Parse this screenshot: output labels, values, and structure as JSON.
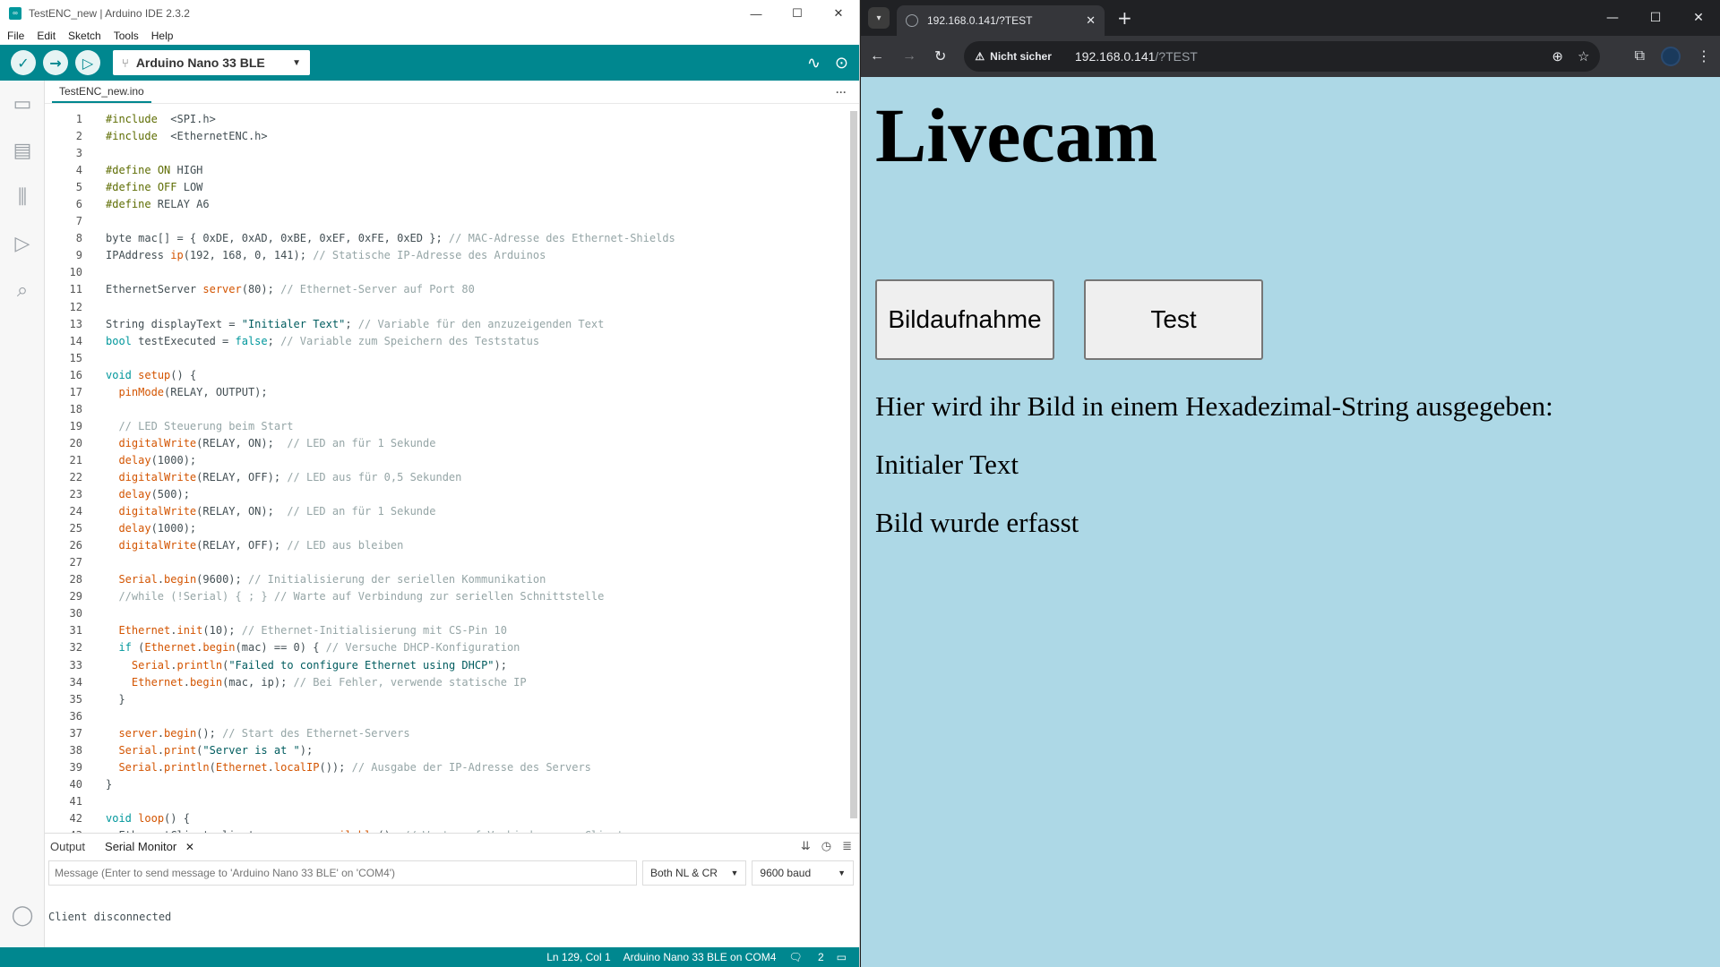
{
  "ide": {
    "window_title": "TestENC_new | Arduino IDE 2.3.2",
    "menu": [
      "File",
      "Edit",
      "Sketch",
      "Tools",
      "Help"
    ],
    "board": "Arduino Nano 33 BLE",
    "file_tab": "TestENC_new.ino",
    "code_lines": [
      [
        [
          "pp",
          "#include"
        ],
        [
          "",
          "  "
        ],
        [
          "",
          "<SPI.h>"
        ]
      ],
      [
        [
          "pp",
          "#include"
        ],
        [
          "",
          "  "
        ],
        [
          "",
          "<EthernetENC.h>"
        ]
      ],
      [],
      [
        [
          "pp",
          "#define"
        ],
        [
          "",
          " "
        ],
        [
          "pp",
          "ON"
        ],
        [
          "",
          " HIGH"
        ]
      ],
      [
        [
          "pp",
          "#define"
        ],
        [
          "",
          " "
        ],
        [
          "pp",
          "OFF"
        ],
        [
          "",
          " LOW"
        ]
      ],
      [
        [
          "pp",
          "#define"
        ],
        [
          "",
          " RELAY A6"
        ]
      ],
      [],
      [
        [
          "",
          "byte mac[] = { 0xDE, 0xAD, 0xBE, 0xEF, 0xFE, 0xED }; "
        ],
        [
          "cm",
          "// MAC-Adresse des Ethernet-Shields"
        ]
      ],
      [
        [
          "",
          "IPAddress "
        ],
        [
          "fn",
          "ip"
        ],
        [
          "",
          "(192, 168, 0, 141); "
        ],
        [
          "cm",
          "// Statische IP-Adresse des Arduinos"
        ]
      ],
      [],
      [
        [
          "",
          "EthernetServer "
        ],
        [
          "fn",
          "server"
        ],
        [
          "",
          "(80); "
        ],
        [
          "cm",
          "// Ethernet-Server auf Port 80"
        ]
      ],
      [],
      [
        [
          "",
          "String displayText = "
        ],
        [
          "str",
          "\"Initialer Text\""
        ],
        [
          "",
          "; "
        ],
        [
          "cm",
          "// Variable für den anzuzeigenden Text"
        ]
      ],
      [
        [
          "kw",
          "bool"
        ],
        [
          "",
          " testExecuted = "
        ],
        [
          "kw",
          "false"
        ],
        [
          "",
          "; "
        ],
        [
          "cm",
          "// Variable zum Speichern des Teststatus"
        ]
      ],
      [],
      [
        [
          "kw",
          "void"
        ],
        [
          "",
          " "
        ],
        [
          "fn",
          "setup"
        ],
        [
          "",
          "() {"
        ]
      ],
      [
        [
          "",
          "  "
        ],
        [
          "fn",
          "pinMode"
        ],
        [
          "",
          "(RELAY, OUTPUT);"
        ]
      ],
      [],
      [
        [
          "cm",
          "  // LED Steuerung beim Start"
        ]
      ],
      [
        [
          "",
          "  "
        ],
        [
          "fn",
          "digitalWrite"
        ],
        [
          "",
          "(RELAY, ON);  "
        ],
        [
          "cm",
          "// LED an für 1 Sekunde"
        ]
      ],
      [
        [
          "",
          "  "
        ],
        [
          "fn",
          "delay"
        ],
        [
          "",
          "(1000);"
        ]
      ],
      [
        [
          "",
          "  "
        ],
        [
          "fn",
          "digitalWrite"
        ],
        [
          "",
          "(RELAY, OFF); "
        ],
        [
          "cm",
          "// LED aus für 0,5 Sekunden"
        ]
      ],
      [
        [
          "",
          "  "
        ],
        [
          "fn",
          "delay"
        ],
        [
          "",
          "(500);"
        ]
      ],
      [
        [
          "",
          "  "
        ],
        [
          "fn",
          "digitalWrite"
        ],
        [
          "",
          "(RELAY, ON);  "
        ],
        [
          "cm",
          "// LED an für 1 Sekunde"
        ]
      ],
      [
        [
          "",
          "  "
        ],
        [
          "fn",
          "delay"
        ],
        [
          "",
          "(1000);"
        ]
      ],
      [
        [
          "",
          "  "
        ],
        [
          "fn",
          "digitalWrite"
        ],
        [
          "",
          "(RELAY, OFF); "
        ],
        [
          "cm",
          "// LED aus bleiben"
        ]
      ],
      [],
      [
        [
          "",
          "  "
        ],
        [
          "fn",
          "Serial"
        ],
        [
          "",
          "."
        ],
        [
          "fn",
          "begin"
        ],
        [
          "",
          "(9600); "
        ],
        [
          "cm",
          "// Initialisierung der seriellen Kommunikation"
        ]
      ],
      [
        [
          "cm",
          "  //while (!Serial) { ; } // Warte auf Verbindung zur seriellen Schnittstelle"
        ]
      ],
      [],
      [
        [
          "",
          "  "
        ],
        [
          "fn",
          "Ethernet"
        ],
        [
          "",
          "."
        ],
        [
          "fn",
          "init"
        ],
        [
          "",
          "(10); "
        ],
        [
          "cm",
          "// Ethernet-Initialisierung mit CS-Pin 10"
        ]
      ],
      [
        [
          "",
          "  "
        ],
        [
          "kw",
          "if"
        ],
        [
          "",
          " ("
        ],
        [
          "fn",
          "Ethernet"
        ],
        [
          "",
          "."
        ],
        [
          "fn",
          "begin"
        ],
        [
          "",
          "(mac) == 0) { "
        ],
        [
          "cm",
          "// Versuche DHCP-Konfiguration"
        ]
      ],
      [
        [
          "",
          "    "
        ],
        [
          "fn",
          "Serial"
        ],
        [
          "",
          "."
        ],
        [
          "fn",
          "println"
        ],
        [
          "",
          "("
        ],
        [
          "str",
          "\"Failed to configure Ethernet using DHCP\""
        ],
        [
          "",
          ");"
        ]
      ],
      [
        [
          "",
          "    "
        ],
        [
          "fn",
          "Ethernet"
        ],
        [
          "",
          "."
        ],
        [
          "fn",
          "begin"
        ],
        [
          "",
          "(mac, ip); "
        ],
        [
          "cm",
          "// Bei Fehler, verwende statische IP"
        ]
      ],
      [
        [
          "",
          "  }"
        ]
      ],
      [],
      [
        [
          "",
          "  "
        ],
        [
          "fn",
          "server"
        ],
        [
          "",
          "."
        ],
        [
          "fn",
          "begin"
        ],
        [
          "",
          "(); "
        ],
        [
          "cm",
          "// Start des Ethernet-Servers"
        ]
      ],
      [
        [
          "",
          "  "
        ],
        [
          "fn",
          "Serial"
        ],
        [
          "",
          "."
        ],
        [
          "fn",
          "print"
        ],
        [
          "",
          "("
        ],
        [
          "str",
          "\"Server is at \""
        ],
        [
          "",
          ");"
        ]
      ],
      [
        [
          "",
          "  "
        ],
        [
          "fn",
          "Serial"
        ],
        [
          "",
          "."
        ],
        [
          "fn",
          "println"
        ],
        [
          "",
          "("
        ],
        [
          "fn",
          "Ethernet"
        ],
        [
          "",
          "."
        ],
        [
          "fn",
          "localIP"
        ],
        [
          "",
          "()); "
        ],
        [
          "cm",
          "// Ausgabe der IP-Adresse des Servers"
        ]
      ],
      [
        [
          "",
          "}"
        ]
      ],
      [],
      [
        [
          "kw",
          "void"
        ],
        [
          "",
          " "
        ],
        [
          "fn",
          "loop"
        ],
        [
          "",
          "() {"
        ]
      ],
      [
        [
          "",
          "  EthernetClient client = "
        ],
        [
          "fn",
          "server"
        ],
        [
          "",
          "."
        ],
        [
          "fn",
          "available"
        ],
        [
          "",
          "(); "
        ],
        [
          "cm",
          "// Warte auf Verbindung vom Client"
        ]
      ]
    ],
    "monitor": {
      "tab_output": "Output",
      "tab_serial": "Serial Monitor",
      "input_placeholder": "Message (Enter to send message to 'Arduino Nano 33 BLE' on 'COM4')",
      "line_ending": "Both NL & CR",
      "baud": "9600 baud",
      "output_text": "Client disconnected"
    },
    "status": {
      "position": "Ln 129, Col 1",
      "board_port": "Arduino Nano 33 BLE on COM4",
      "notifications": "2"
    }
  },
  "browser": {
    "tab_title": "192.168.0.141/?TEST",
    "security_label": "Nicht sicher",
    "url_host": "192.168.0.141",
    "url_path": "/?TEST",
    "page": {
      "heading": "Livecam",
      "button_capture": "Bildaufnahme",
      "button_test": "Test",
      "info_text": "Hier wird ihr Bild in einem Hexadezimal-String ausgegeben:",
      "display_text": "Initialer Text",
      "status_text": "Bild wurde erfasst"
    }
  }
}
